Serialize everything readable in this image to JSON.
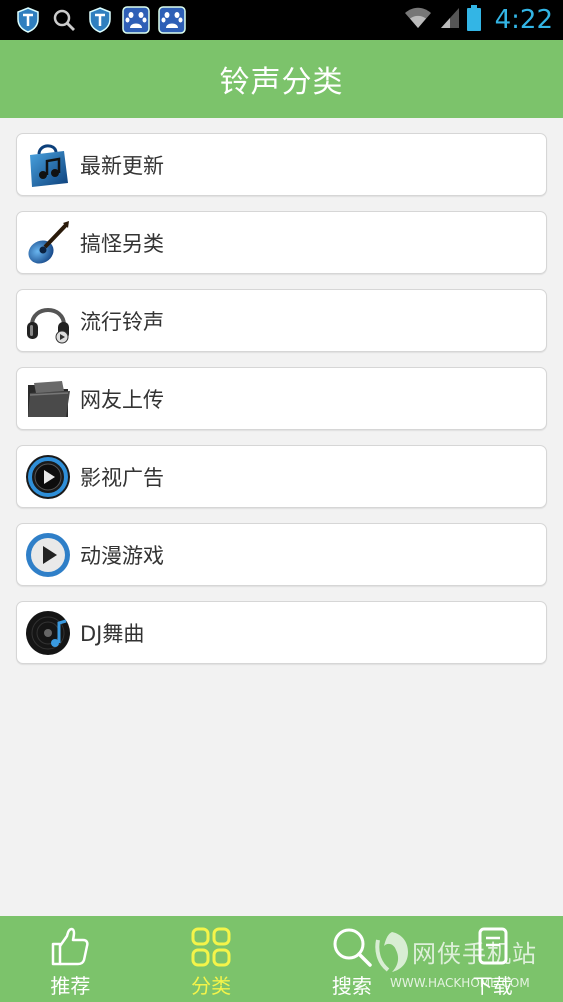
{
  "status_bar": {
    "time": "4:22",
    "left_icons": [
      "shield-icon",
      "search-icon",
      "shield-icon",
      "baidu-icon",
      "baidu-icon"
    ],
    "right_icons": [
      "wifi-icon",
      "signal-icon",
      "battery-icon"
    ]
  },
  "header": {
    "title": "铃声分类"
  },
  "categories": [
    {
      "label": "最新更新",
      "icon": "shopping-bag-music-icon"
    },
    {
      "label": "搞怪另类",
      "icon": "guitar-icon"
    },
    {
      "label": "流行铃声",
      "icon": "headphones-icon"
    },
    {
      "label": "网友上传",
      "icon": "folder-icon"
    },
    {
      "label": "影视广告",
      "icon": "play-disc-icon"
    },
    {
      "label": "动漫游戏",
      "icon": "play-circle-icon"
    },
    {
      "label": "DJ舞曲",
      "icon": "vinyl-music-icon"
    }
  ],
  "bottom_nav": {
    "items": [
      {
        "label": "推荐",
        "icon": "thumbs-up-icon"
      },
      {
        "label": "分类",
        "icon": "grid-icon",
        "active": true
      },
      {
        "label": "搜索",
        "icon": "search-icon"
      },
      {
        "label": "下载",
        "icon": "download-icon"
      }
    ]
  },
  "watermark": {
    "cn": "网侠手机站",
    "en": "WWW.HACKHOME.COM"
  },
  "colors": {
    "header": "#7cc36b",
    "bottom_nav": "#7cc36b",
    "active_nav": "#f4f44a",
    "status_time": "#33b5e5",
    "background": "#f2f2f2"
  }
}
